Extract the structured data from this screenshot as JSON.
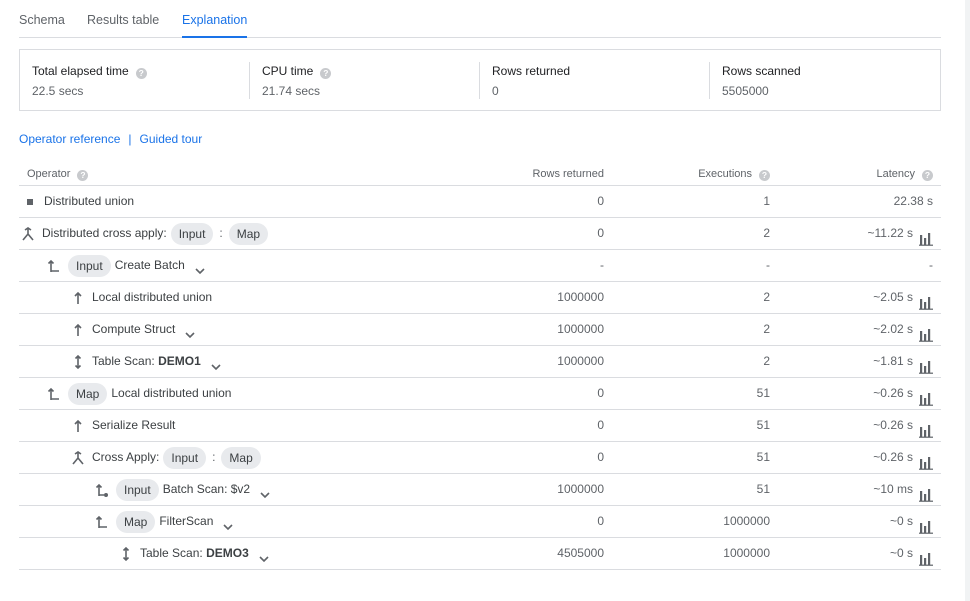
{
  "tabs": [
    {
      "label": "Schema"
    },
    {
      "label": "Results table"
    },
    {
      "label": "Explanation"
    }
  ],
  "summary": {
    "elapsed_label": "Total elapsed time",
    "elapsed_value": "22.5 secs",
    "cpu_label": "CPU time",
    "cpu_value": "21.74 secs",
    "rows_returned_label": "Rows returned",
    "rows_returned_value": "0",
    "rows_scanned_label": "Rows scanned",
    "rows_scanned_value": "5505000"
  },
  "links": {
    "operator_reference": "Operator reference",
    "separator": "|",
    "guided_tour": "Guided tour"
  },
  "table": {
    "headers": {
      "operator": "Operator",
      "rows_returned": "Rows returned",
      "executions": "Executions",
      "latency": "Latency"
    },
    "rows": [
      {
        "icon": "square",
        "chips": [],
        "label": "Distributed union",
        "bold": "",
        "rows": "0",
        "executions": "1",
        "latency": "22.38 s",
        "chart": false,
        "chevron": false
      },
      {
        "icon": "cross-apply",
        "chips": [
          "Input",
          "Map"
        ],
        "label": "Distributed cross apply:",
        "bold": "",
        "rows": "0",
        "executions": "2",
        "latency": "~11.22 s",
        "chart": true,
        "chevron": false
      },
      {
        "icon": "branch",
        "chips": [
          "Input"
        ],
        "label": "Create Batch",
        "bold": "",
        "rows": "-",
        "executions": "-",
        "latency": "-",
        "chart": false,
        "chevron": true
      },
      {
        "icon": "arrow-up",
        "chips": [],
        "label": "Local distributed union",
        "bold": "",
        "rows": "1000000",
        "executions": "2",
        "latency": "~2.05 s",
        "chart": true,
        "chevron": false
      },
      {
        "icon": "arrow-up",
        "chips": [],
        "label": "Compute Struct",
        "bold": "",
        "rows": "1000000",
        "executions": "2",
        "latency": "~2.02 s",
        "chart": true,
        "chevron": true
      },
      {
        "icon": "arrow-updown",
        "chips": [],
        "label": "Table Scan:",
        "bold": "DEMO1",
        "rows": "1000000",
        "executions": "2",
        "latency": "~1.81 s",
        "chart": true,
        "chevron": true
      },
      {
        "icon": "branch",
        "chips": [
          "Map"
        ],
        "label": "Local distributed union",
        "bold": "",
        "rows": "0",
        "executions": "51",
        "latency": "~0.26 s",
        "chart": true,
        "chevron": false
      },
      {
        "icon": "arrow-up",
        "chips": [],
        "label": "Serialize Result",
        "bold": "",
        "rows": "0",
        "executions": "51",
        "latency": "~0.26 s",
        "chart": true,
        "chevron": false
      },
      {
        "icon": "cross-apply",
        "chips": [
          "Input",
          "Map"
        ],
        "label": "Cross Apply:",
        "bold": "",
        "rows": "0",
        "executions": "51",
        "latency": "~0.26 s",
        "chart": true,
        "chevron": false
      },
      {
        "icon": "branch-dot",
        "chips": [
          "Input"
        ],
        "label": "Batch Scan: $v2",
        "bold": "",
        "rows": "1000000",
        "executions": "51",
        "latency": "~10 ms",
        "chart": true,
        "chevron": true
      },
      {
        "icon": "branch",
        "chips": [
          "Map"
        ],
        "label": "FilterScan",
        "bold": "",
        "rows": "0",
        "executions": "1000000",
        "latency": "~0 s",
        "chart": true,
        "chevron": true
      },
      {
        "icon": "arrow-updown",
        "chips": [],
        "label": "Table Scan:",
        "bold": "DEMO3",
        "rows": "4505000",
        "executions": "1000000",
        "latency": "~0 s",
        "chart": true,
        "chevron": true
      }
    ]
  }
}
